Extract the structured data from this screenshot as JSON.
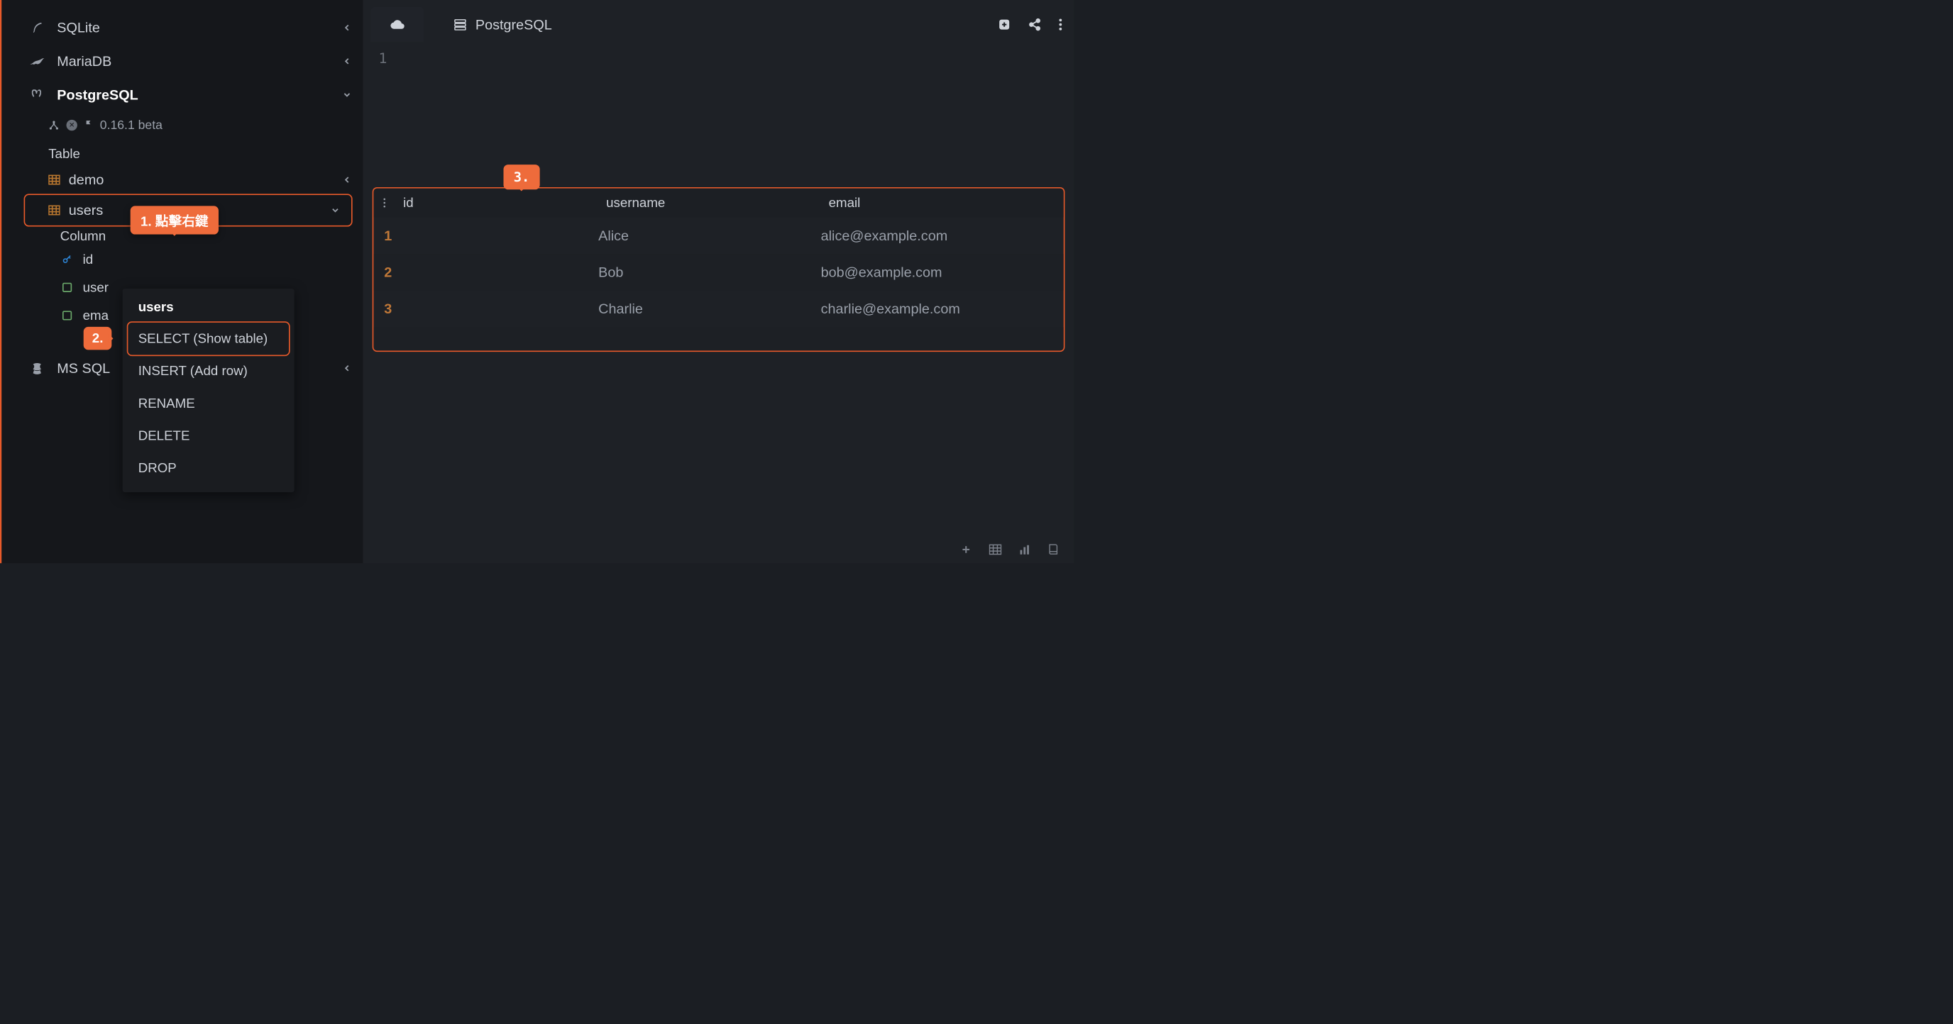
{
  "sidebar": {
    "databases": [
      {
        "name": "SQLite",
        "expanded": false
      },
      {
        "name": "MariaDB",
        "expanded": false
      },
      {
        "name": "PostgreSQL",
        "expanded": true
      },
      {
        "name": "MS SQL",
        "expanded": false
      }
    ],
    "version": "0.16.1 beta",
    "section_table": "Table",
    "tables": [
      {
        "name": "demo",
        "selected": false
      },
      {
        "name": "users",
        "selected": true
      }
    ],
    "section_column": "Column",
    "columns": [
      {
        "name": "id",
        "key": true,
        "truncated": ""
      },
      {
        "name": "username",
        "key": false,
        "truncated": "user"
      },
      {
        "name": "email",
        "key": false,
        "truncated": "ema"
      }
    ]
  },
  "context_menu": {
    "title": "users",
    "items": [
      "SELECT (Show table)",
      "INSERT (Add row)",
      "RENAME",
      "DELETE",
      "DROP"
    ]
  },
  "annotations": {
    "a1": "1. 點擊右鍵",
    "a2": "2.",
    "a3": "3."
  },
  "tabs": {
    "active": "PostgreSQL"
  },
  "editor": {
    "line_number": "1"
  },
  "result": {
    "columns": [
      "id",
      "username",
      "email"
    ],
    "rows": [
      {
        "n": "1",
        "id": "",
        "username": "Alice",
        "email": "alice@example.com"
      },
      {
        "n": "2",
        "id": "",
        "username": "Bob",
        "email": "bob@example.com"
      },
      {
        "n": "3",
        "id": "",
        "username": "Charlie",
        "email": "charlie@example.com"
      }
    ]
  }
}
